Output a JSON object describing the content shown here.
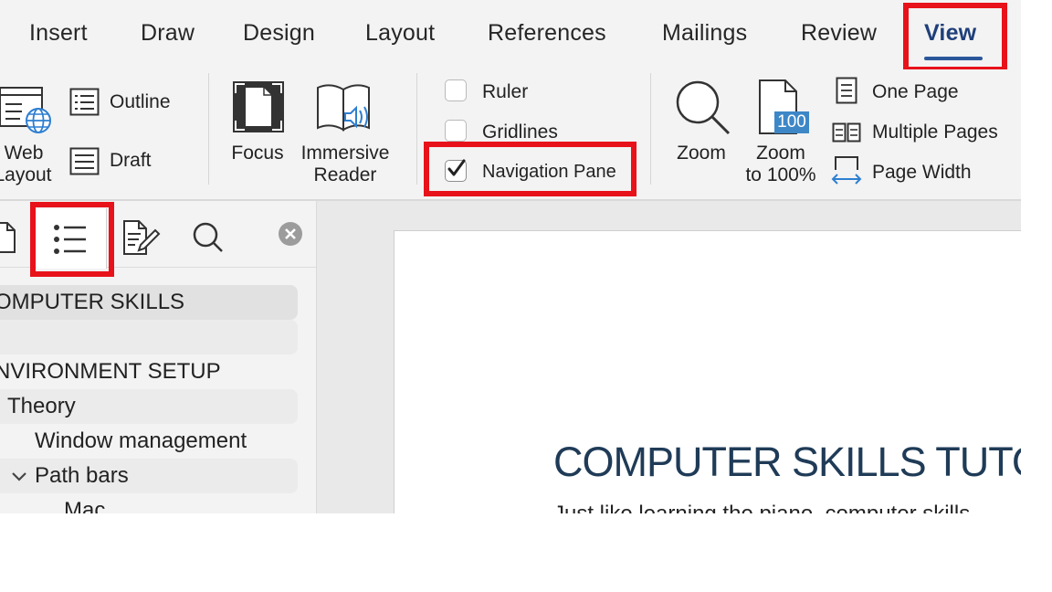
{
  "tabs": [
    "Insert",
    "Draw",
    "Design",
    "Layout",
    "References",
    "Mailings",
    "Review",
    "View"
  ],
  "active_tab": "View",
  "ribbon": {
    "views": {
      "web_layout_line1": "Web",
      "web_layout_line2": "Layout",
      "outline": "Outline",
      "draft": "Draft"
    },
    "immersive": {
      "focus": "Focus",
      "immersive_reader_line1": "Immersive",
      "immersive_reader_line2": "Reader"
    },
    "show": {
      "ruler": {
        "label": "Ruler",
        "checked": false
      },
      "gridlines": {
        "label": "Gridlines",
        "checked": false
      },
      "navigation_pane": {
        "label": "Navigation Pane",
        "checked": true
      }
    },
    "zoom": {
      "zoom": "Zoom",
      "zoom100_line1": "Zoom",
      "zoom100_line2": "to 100%",
      "zoom100_badge": "100",
      "one_page": "One Page",
      "multiple_pages": "Multiple Pages",
      "page_width": "Page Width"
    }
  },
  "nav_pane": {
    "tabs": [
      "pages",
      "headings",
      "edits",
      "search"
    ],
    "selected_tab": "headings",
    "headings": [
      {
        "text": "OMPUTER SKILLS",
        "level": 1,
        "selected": true
      },
      {
        "text": "",
        "level": 1
      },
      {
        "text": "NVIRONMENT SETUP",
        "level": 1
      },
      {
        "text": "Theory",
        "level": 2
      },
      {
        "text": "Window management",
        "level": 3
      },
      {
        "text": "Path bars",
        "level": 3,
        "expanded": true
      },
      {
        "text": "Mac",
        "level": 4
      }
    ]
  },
  "document": {
    "title": "COMPUTER SKILLS TUTO",
    "body_start": "Just like learning the piano, computer skills"
  },
  "colors": {
    "highlight": "#e8121a",
    "accent": "#2b579a",
    "zoom_badge": "#3d87c7",
    "title": "#1f3b57"
  }
}
